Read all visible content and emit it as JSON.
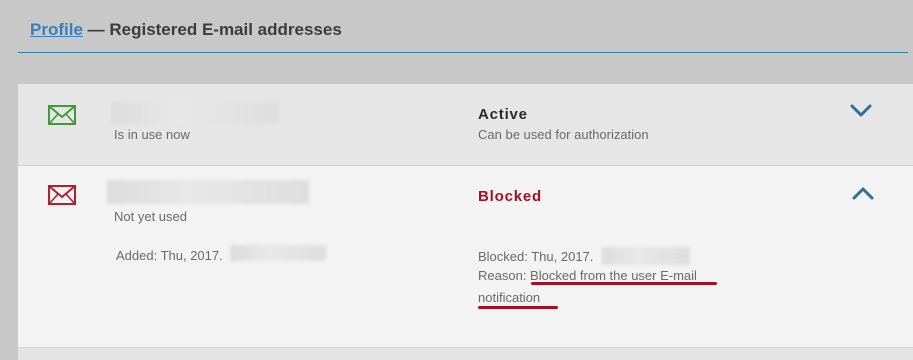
{
  "header": {
    "profile_link": "Profile",
    "title_rest": " — Registered E-mail addresses"
  },
  "emails": [
    {
      "usage": "Is in use now",
      "status": "Active",
      "status_desc": "Can be used for authorization",
      "icon": "envelope-icon",
      "icon_color": "#3f9a3a",
      "status_color": "#2a2a2a",
      "expanded": false
    },
    {
      "usage": "Not yet used",
      "status": "Blocked",
      "icon": "envelope-icon",
      "icon_color": "#b01f2e",
      "status_color": "#a11028",
      "expanded": true,
      "added_label": "Added: Thu, 2017.",
      "blocked_label": "Blocked: Thu, 2017.",
      "reason_label": "Reason: ",
      "reason_line1": "Blocked from the user E-mail",
      "reason_line2": "notification"
    }
  ],
  "colors": {
    "chevron": "#2f6f99",
    "underline": "#a11028",
    "link": "#3a7fb8"
  }
}
